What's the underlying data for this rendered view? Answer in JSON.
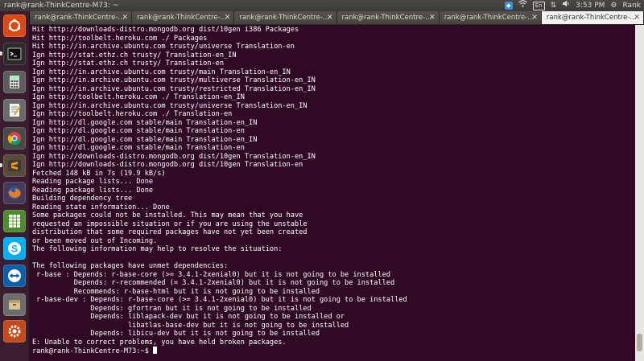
{
  "window": {
    "title": "rank@rank-ThinkCentre-M73: ~"
  },
  "top_panel": {
    "keyboard_layout": "En",
    "time": "3:53 PM",
    "user": "Rank"
  },
  "launcher": {
    "items": [
      {
        "name": "ubuntu-dash-icon",
        "color": "#dd4814"
      },
      {
        "name": "terminal-icon",
        "color": "#2b2b2b"
      },
      {
        "name": "calculator-icon",
        "color": "#5d5d5d"
      },
      {
        "name": "text-editor-icon",
        "color": "#6b6b6b"
      },
      {
        "name": "chrome-icon",
        "color": "#4a4a4a"
      },
      {
        "name": "sublime-text-icon",
        "color": "#5a4a3a"
      },
      {
        "name": "firefox-icon",
        "color": "#4a3a5a"
      },
      {
        "name": "spreadsheet-icon",
        "color": "#4e8a2e"
      },
      {
        "name": "skype-icon",
        "color": "#00aff0"
      },
      {
        "name": "teamviewer-icon",
        "color": "#0e5ea8"
      },
      {
        "name": "archive-manager-icon",
        "color": "#6d6d6d"
      },
      {
        "name": "system-settings-icon",
        "color": "#c44a1a"
      }
    ]
  },
  "tabs": [
    {
      "label": "rank@rank-ThinkCentre-...",
      "active": false
    },
    {
      "label": "rank@rank-ThinkCentre-...",
      "active": false
    },
    {
      "label": "rank@rank-ThinkCentre-...",
      "active": false
    },
    {
      "label": "rank@rank-ThinkCentre-...",
      "active": false
    },
    {
      "label": "rank@rank-ThinkCentre-...",
      "active": false
    },
    {
      "label": "rank@rank-ThinkCentre-...",
      "active": true
    }
  ],
  "terminal": {
    "lines": [
      "Hit http://downloads-distro.mongodb.org dist/10gen i386 Packages",
      "Hit http://toolbelt.heroku.com ./ Packages",
      "Hit http://in.archive.ubuntu.com trusty/universe Translation-en",
      "Ign http://stat.ethz.ch trusty/ Translation-en_IN",
      "Ign http://stat.ethz.ch trusty/ Translation-en",
      "Ign http://in.archive.ubuntu.com trusty/main Translation-en_IN",
      "Ign http://in.archive.ubuntu.com trusty/multiverse Translation-en_IN",
      "Ign http://in.archive.ubuntu.com trusty/restricted Translation-en_IN",
      "Ign http://toolbelt.heroku.com ./ Translation-en_IN",
      "Ign http://in.archive.ubuntu.com trusty/universe Translation-en_IN",
      "Ign http://toolbelt.heroku.com ./ Translation-en",
      "Ign http://dl.google.com stable/main Translation-en_IN",
      "Ign http://dl.google.com stable/main Translation-en",
      "Ign http://dl.google.com stable/main Translation-en_IN",
      "Ign http://dl.google.com stable/main Translation-en",
      "Ign http://downloads-distro.mongodb.org dist/10gen Translation-en_IN",
      "Ign http://downloads-distro.mongodb.org dist/10gen Translation-en",
      "Fetched 148 kB in 7s (19.9 kB/s)",
      "Reading package lists... Done",
      "Reading package lists... Done",
      "Building dependency tree",
      "Reading state information... Done",
      "Some packages could not be installed. This may mean that you have",
      "requested an impossible situation or if you are using the unstable",
      "distribution that some required packages have not yet been created",
      "or been moved out of Incoming.",
      "The following information may help to resolve the situation:",
      "",
      "The following packages have unmet dependencies:",
      " r-base : Depends: r-base-core (>= 3.4.1-2xenial0) but it is not going to be installed",
      "          Depends: r-recommended (= 3.4.1-2xenial0) but it is not going to be installed",
      "          Recommends: r-base-html but it is not going to be installed",
      " r-base-dev : Depends: r-base-core (>= 3.4.1-2xenial0) but it is not going to be installed",
      "              Depends: gfortran but it is not going to be installed",
      "              Depends: liblapack-dev but it is not going to be installed or",
      "                       libatlas-base-dev but it is not going to be installed",
      "              Depends: libicu-dev but it is not going to be installed",
      "E: Unable to correct problems, you have held broken packages."
    ],
    "prompt": "rank@rank-ThinkCentre-M73:~$ "
  },
  "scrollbar": {
    "position_fraction": 0.97
  }
}
